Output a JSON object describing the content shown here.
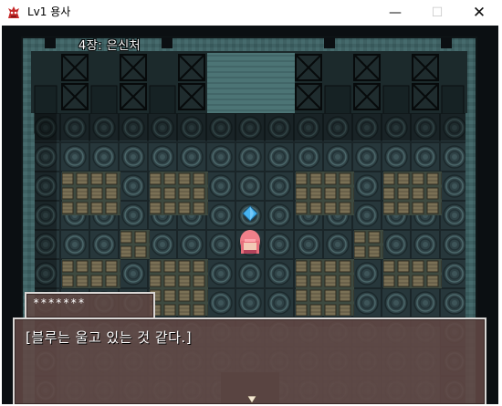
{
  "window": {
    "title": "Lv1 용사",
    "icon": "dragon-app-icon",
    "controls": {
      "minimize": "—",
      "maximize": "☐",
      "close": "✕"
    }
  },
  "hud": {
    "chapter_title": "4장: 은신처"
  },
  "dialog": {
    "speaker": "*******",
    "text": "[블루는 울고 있는 것 같다.]"
  },
  "colors": {
    "wall": "#3f6163",
    "wall_dark": "#1e2c2e",
    "floor": "#2c3e42",
    "floor_ring": "#455f62",
    "crate": "#6f6954",
    "message_bg": "#624844",
    "message_border": "#d9d6d4",
    "hero_hair": "#f0808a",
    "crystal": "#46b3f0"
  },
  "scene": {
    "description_icons": [
      "pink-haired-hero-sprite",
      "blue-crystal-icon",
      "x-braced-wall-panel",
      "wooden-crate",
      "circular-floor-tile"
    ]
  }
}
